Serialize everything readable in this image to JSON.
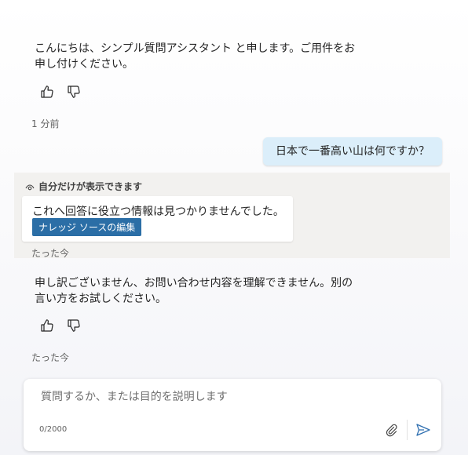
{
  "conversation": {
    "greeting_line1": "こんにちは、シンプル質問アシスタント と申します。ご用件をお",
    "greeting_line2": "申し付けください。",
    "greeting_time": "1 分前",
    "user_message": "日本で一番高い山は何ですか？",
    "private_notice": {
      "header": "自分だけが表示できます",
      "message": "これへ回答に役立つ情報は見つかりませんでした。",
      "button_label": "ナレッジ ソースの編集",
      "time": "たった今"
    },
    "fallback_line1": "申し訳ございません、お問い合わせ内容を理解できません。別の",
    "fallback_line2": "言い方をお試しください。",
    "fallback_time": "たった今"
  },
  "composer": {
    "placeholder": "質問するか、または目的を説明します",
    "value": "",
    "char_count": "0/2000"
  },
  "icons": {
    "like": "thumbs-up-icon",
    "dislike": "thumbs-down-icon",
    "visibility": "eye-icon",
    "attach": "paperclip-icon",
    "send": "send-icon"
  },
  "colors": {
    "user_bubble": "#dbeefa",
    "private_panel": "#f2f1ef",
    "button_bg": "#2b6ea6",
    "send_icon": "#2f6fb0"
  }
}
